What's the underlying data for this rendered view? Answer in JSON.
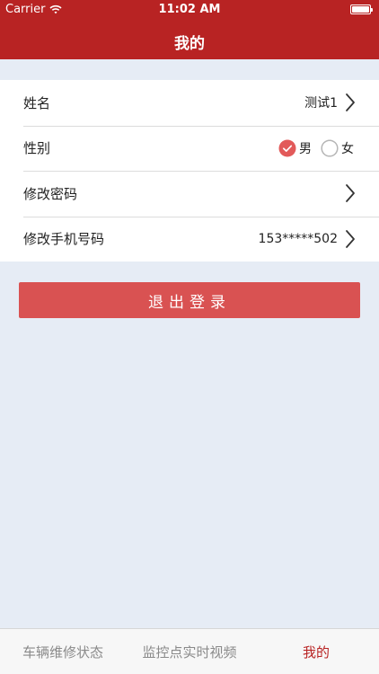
{
  "status_bar": {
    "carrier": "Carrier",
    "time": "11:02 AM",
    "wifi_icon": "wifi-icon",
    "battery_icon": "battery-icon"
  },
  "nav": {
    "title": "我的"
  },
  "colors": {
    "brand": "#b82323",
    "logout": "#d95252",
    "background": "#e6ecf5",
    "radio_checked": "#e25a5a"
  },
  "profile": {
    "name": {
      "label": "姓名",
      "value": "测试1",
      "icon": "chevron-right-icon"
    },
    "gender": {
      "label": "性别",
      "options": [
        {
          "label": "男",
          "selected": true
        },
        {
          "label": "女",
          "selected": false
        }
      ]
    },
    "password": {
      "label": "修改密码",
      "icon": "chevron-right-icon"
    },
    "phone": {
      "label": "修改手机号码",
      "value": "153*****502",
      "icon": "chevron-right-icon"
    }
  },
  "logout_button": {
    "label": "退出登录"
  },
  "tabbar": {
    "tabs": [
      {
        "label": "车辆维修状态",
        "active": false
      },
      {
        "label": "监控点实时视频",
        "active": false
      },
      {
        "label": "我的",
        "active": true
      }
    ]
  }
}
